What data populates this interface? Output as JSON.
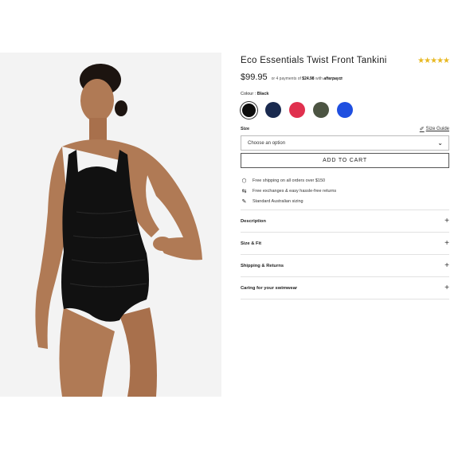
{
  "product": {
    "title": "Eco Essentials Twist Front Tankini",
    "stars": "★★★★★",
    "price": "$99.95",
    "afterpay_prefix": "or 4 payments of",
    "afterpay_amount": "$24.98",
    "afterpay_with": "with",
    "afterpay_brand": "afterpay⇄"
  },
  "colour": {
    "label": "Colour :",
    "selected": "Black",
    "swatches": [
      {
        "name": "Black",
        "hex": "#0d0d0d"
      },
      {
        "name": "Navy",
        "hex": "#1a2a4f"
      },
      {
        "name": "Red",
        "hex": "#e0304e"
      },
      {
        "name": "Olive",
        "hex": "#4c5442"
      },
      {
        "name": "Blue",
        "hex": "#1f4fe0"
      }
    ]
  },
  "size": {
    "label": "Size",
    "guide_label": "Size Guide",
    "guide_icon": "ruler-icon",
    "select_value": "Choose an option",
    "chevron": "⌄"
  },
  "cart": {
    "button_label": "ADD TO CART"
  },
  "features": [
    {
      "icon": "box-icon",
      "glyph": "⬡",
      "text": "Free shipping on all orders over $150"
    },
    {
      "icon": "return-arrow-icon",
      "glyph": "⇆",
      "text": "Free exchanges & easy hassle-free returns"
    },
    {
      "icon": "pencil-icon",
      "glyph": "✎",
      "text": "Standard Australian sizing"
    }
  ],
  "accordions": [
    {
      "label": "Description",
      "icon": "+"
    },
    {
      "label": "Size & Fit",
      "icon": "+"
    },
    {
      "label": "Shipping & Returns",
      "icon": "+"
    },
    {
      "label": "Caring for your swimwear",
      "icon": "+"
    }
  ]
}
